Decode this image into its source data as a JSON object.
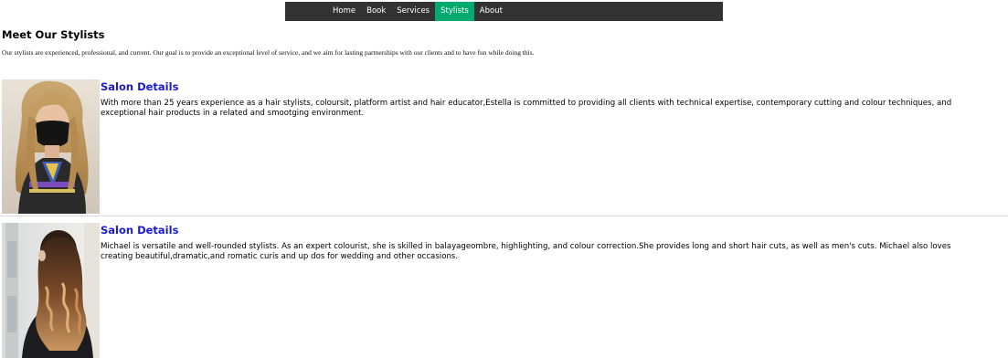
{
  "nav": {
    "items": [
      {
        "label": "Home",
        "active": false
      },
      {
        "label": "Book",
        "active": false
      },
      {
        "label": "Services",
        "active": false
      },
      {
        "label": "Stylists",
        "active": true
      },
      {
        "label": "About",
        "active": false
      }
    ],
    "active_color": "#04aa6d",
    "bar_color": "#333333"
  },
  "page": {
    "title": "Meet Our Stylists",
    "intro": "Our stylists are experienced, professional, and current. Our goal is to provide an exceptional level of service, and we aim for lasting partnerships with our clients and to have fun while doing this."
  },
  "stylists": [
    {
      "heading": "Salon Details",
      "bio": "With more than 25 years experience as a hair stylists, coloursit, platform artist and hair educator,Estella is committed to providing all clients with technical expertise, contemporary cutting and colour techniques, and exceptional hair products in a related and smootging environment."
    },
    {
      "heading": "Salon Details",
      "bio": "Michael is versatile and well-rounded stylists. As an expert colourist, she is skilled in balayageombre, highlighting, and colour correction.She provides long and short hair cuts, as well as men's cuts. Michael also loves creating beautiful,dramatic,and romatic curis and up dos for wedding and other occasions."
    }
  ],
  "colors": {
    "link": "#1a1ad0"
  }
}
